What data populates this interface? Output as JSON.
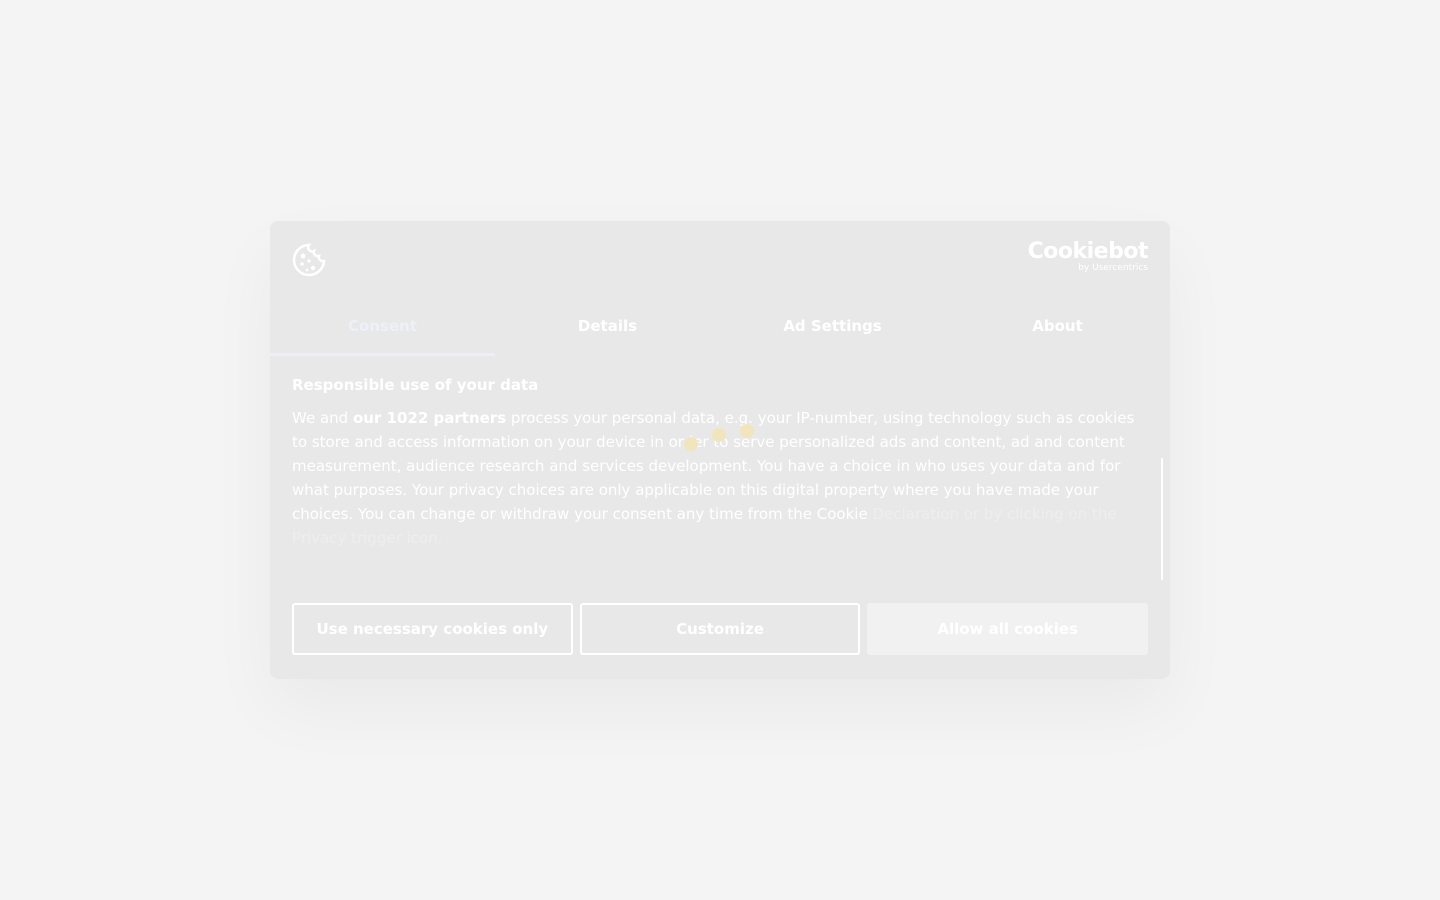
{
  "brand": {
    "name": "Cookiebot",
    "sub": "by Usercentrics"
  },
  "tabs": [
    {
      "label": "Consent",
      "active": true
    },
    {
      "label": "Details",
      "active": false
    },
    {
      "label": "Ad Settings",
      "active": false
    },
    {
      "label": "About",
      "active": false
    }
  ],
  "content": {
    "title": "Responsible use of your data",
    "body_prefix": "We and ",
    "body_bold": "our 1022 partners",
    "body_main": " process your personal data, e.g. your IP-number, using technology such as cookies to store and access information on your device in order to serve personalized ads and content, ad and content measurement, audience research and services development. You have a choice in who uses your data and for what purposes. Your privacy choices are only applicable on this digital property where you have made your choices. You can change or withdraw your consent any time from the Cookie",
    "body_faint": "Declaration or by clicking on the Privacy trigger icon."
  },
  "buttons": {
    "necessary": "Use necessary cookies only",
    "customize": "Customize",
    "allow_all": "Allow all cookies"
  },
  "icons": {
    "cookie": "cookie-icon",
    "loader": "loading-dots"
  },
  "colors": {
    "page_background": "#f4f4f4",
    "dialog_background": "#e8e8e8",
    "loader_dot": "#f1e5bd"
  }
}
